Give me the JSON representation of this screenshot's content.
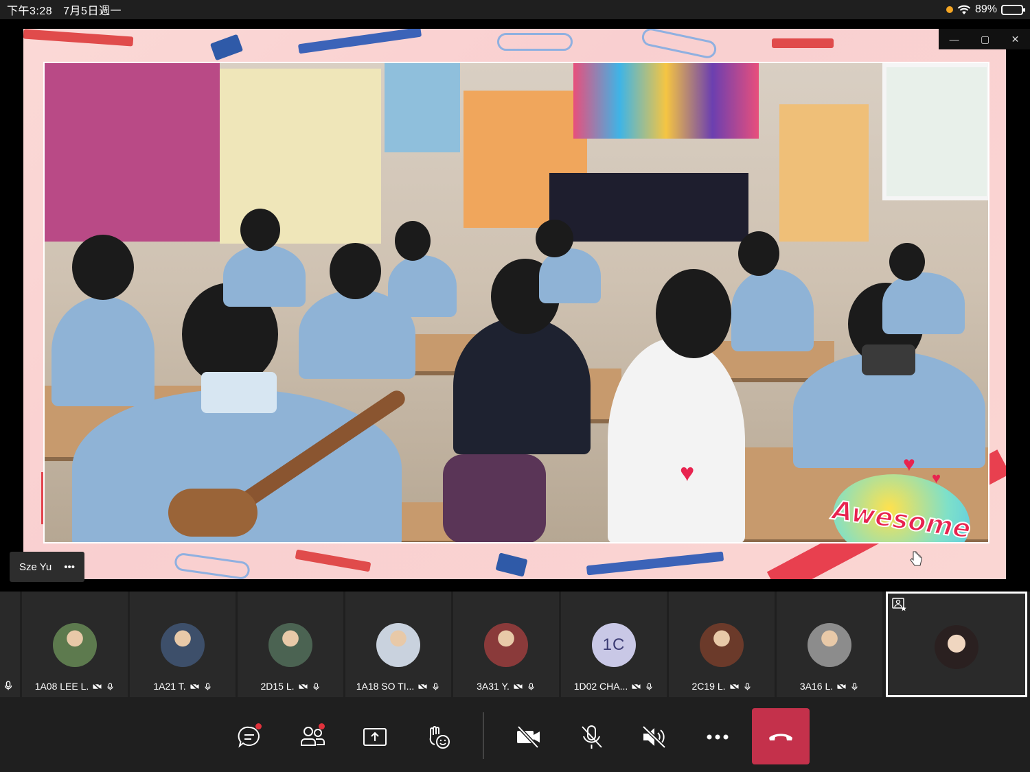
{
  "status_bar": {
    "time": "下午3:28",
    "date": "7月5日週一",
    "battery": "89%",
    "battery_level": 0.89
  },
  "presenter": {
    "name": "Sze Yu",
    "more_label": "•••",
    "sticker_text": "Awesome"
  },
  "window_controls": {
    "minimize": "—",
    "restore": "▢",
    "close": "✕"
  },
  "participants": [
    {
      "name": "1A08 LEE L.",
      "avatar": "photo"
    },
    {
      "name": "1A21 T.",
      "avatar": "photo"
    },
    {
      "name": "2D15 L.",
      "avatar": "photo"
    },
    {
      "name": "1A18 SO TI...",
      "avatar": "photo"
    },
    {
      "name": "3A31 Y.",
      "avatar": "photo"
    },
    {
      "name": "1D02 CHA...",
      "avatar": "initials",
      "initials": "1C"
    },
    {
      "name": "2C19 L.",
      "avatar": "photo"
    },
    {
      "name": "3A16 L.",
      "avatar": "photo"
    }
  ],
  "controls": {
    "chat": "chat-icon",
    "people": "people-icon",
    "share": "share-icon",
    "reactions": "reactions-icon",
    "camera": "camera-off-icon",
    "mic": "mic-off-icon",
    "speaker": "speaker-off-icon",
    "more": "more-icon",
    "hangup": "hangup-icon"
  },
  "colors": {
    "hangup": "#c4314b",
    "notification": "#e0323c",
    "background": "#1f1f1f"
  }
}
